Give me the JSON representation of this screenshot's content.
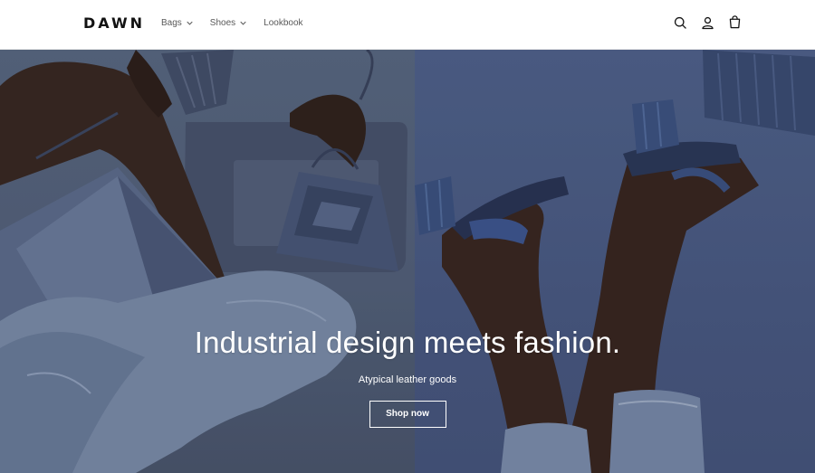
{
  "brand": {
    "logo_text": "DAWN"
  },
  "nav": {
    "items": [
      {
        "label": "Bags",
        "has_dropdown": true
      },
      {
        "label": "Shoes",
        "has_dropdown": true
      },
      {
        "label": "Lookbook",
        "has_dropdown": false
      }
    ]
  },
  "header_icons": [
    "search-icon",
    "account-icon",
    "cart-icon"
  ],
  "hero": {
    "title": "Industrial design meets fashion.",
    "subtitle": "Atypical leather goods",
    "cta_label": "Shop now"
  },
  "colors": {
    "header_bg": "#ffffff",
    "text": "#121212",
    "nav_text": "#595959",
    "hero_left_bg": "#5b6a85",
    "hero_right_bg": "#4b5c86",
    "hero_text": "#ffffff"
  }
}
